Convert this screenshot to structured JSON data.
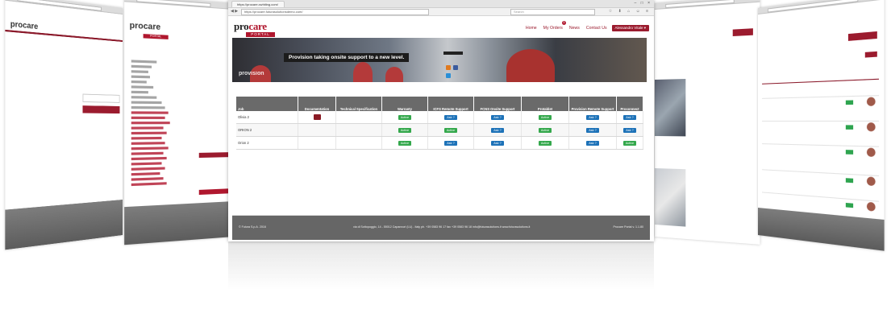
{
  "browser": {
    "tab_title": "https://procare.cwhiting.com/",
    "window_controls": "– □ ×",
    "nav_buttons": "◀ ▶",
    "url": "https://procare.futurasolutionsdemo.com/",
    "search_placeholder": "Search",
    "toolbar_icons": "☆ ⬇ ⌂ ☺ ≡"
  },
  "site": {
    "logo_prefix": "pro",
    "logo_suffix": "care",
    "portal_label": "PORTAL",
    "nav": [
      {
        "label": "Home"
      },
      {
        "label": "My Orders",
        "badge": "3"
      },
      {
        "label": "News"
      },
      {
        "label": "Contact Us"
      }
    ],
    "user_button": "Alessandro Vitale ▾"
  },
  "banner": {
    "tagline": "Provision taking onsite support to a new level.",
    "brand": "provision"
  },
  "table": {
    "headers": [
      "Job",
      "Documentation",
      "Technical Specification",
      "Warranty",
      "ICFS Remote Support",
      "FCNS Onsite Support",
      "Protablet",
      "Provision Remote Support",
      "Proconnect"
    ],
    "rows": [
      {
        "job": "Olivia 2",
        "warranty": "Active",
        "icfs": "Ask ?",
        "fcns": "Ask ?",
        "protablet": "Active",
        "provision": "Ask ?",
        "proconnect": "Ask ?"
      },
      {
        "job": "ORION 2",
        "warranty": "Active",
        "icfs": "Active",
        "fcns": "Ask ?",
        "protablet": "Active",
        "provision": "Ask ?",
        "proconnect": "Ask ?"
      },
      {
        "job": "Orion 2",
        "warranty": "Active",
        "icfs": "Ask ?",
        "fcns": "Ask ?",
        "protablet": "Active",
        "provision": "Ask ?",
        "proconnect": "Active"
      }
    ]
  },
  "footer": {
    "copyright": "© Futura S.p.A. 2016",
    "address": "via di Sottopoggio, 14 - 55012 Capannori (LU) - Italy   ph. +39 0583 96 17   fax +39 0583 96 18   info@futurasolutions.it   www.futurasolutions.it",
    "version": "Procare Portal v. 1.1.80"
  },
  "side_screens": {
    "left_outer_logo": "procare",
    "left_inner_logo": "procare",
    "left_inner_portal": "PORTAL"
  },
  "colors": {
    "brand_red": "#9b1b2e",
    "active_green": "#34a84c",
    "ask_blue": "#1d72b8",
    "header_grey": "#6a6a6a"
  }
}
